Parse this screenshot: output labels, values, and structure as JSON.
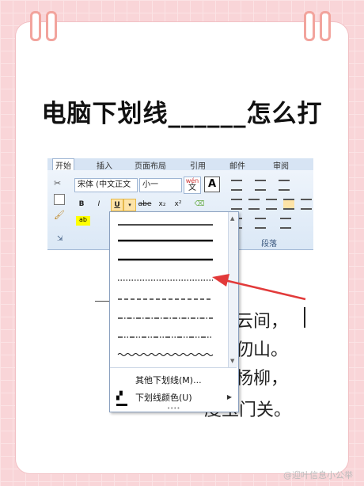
{
  "title": "电脑下划线______怎么打",
  "ribbon": {
    "tabs": [
      "开始",
      "插入",
      "页面布局",
      "引用",
      "邮件",
      "审阅"
    ],
    "font_name": "宋体 (中文正文",
    "font_size": "小一",
    "wen_glyph": "wén\n文",
    "format_buttons": [
      "B",
      "I",
      "U",
      "abe",
      "x₂",
      "x²"
    ],
    "aa_button": "A",
    "group_paragraph": "段落"
  },
  "document_lines": [
    "云间，",
    "仞山。",
    "杨柳，",
    "度玉门关。"
  ],
  "dropdown": {
    "menu": [
      {
        "label": "其他下划线(M)...",
        "icon": "underline-more-icon"
      },
      {
        "label": "下划线颜色(U)",
        "icon": "underline-color-icon"
      }
    ]
  },
  "watermark": "@迎叶信息小公举",
  "colors": {
    "background": "#f9d5d8",
    "ribbon_top": "#eef4fb",
    "arrow": "#e23a3a"
  }
}
